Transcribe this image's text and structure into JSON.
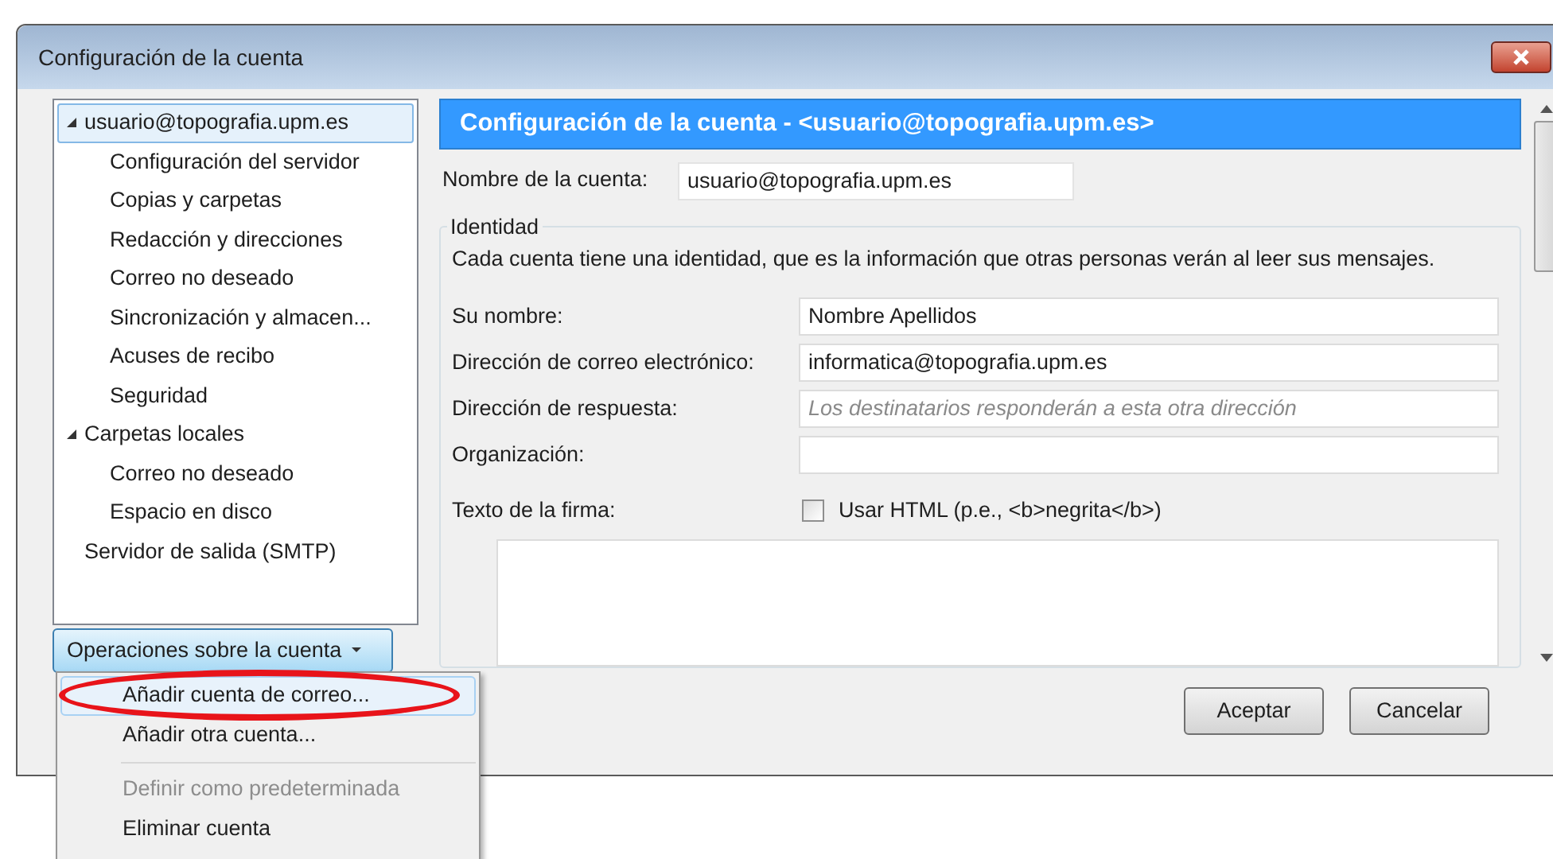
{
  "window": {
    "title": "Configuración de la cuenta"
  },
  "tree": [
    {
      "label": "usuario@topografia.upm.es",
      "selected": true,
      "expanded": true,
      "children": [
        {
          "label": "Configuración del servidor",
          "selected": false
        },
        {
          "label": "Copias y carpetas",
          "selected": false
        },
        {
          "label": "Redacción y direcciones",
          "selected": false
        },
        {
          "label": "Correo no deseado",
          "selected": false
        },
        {
          "label": "Sincronización y almacen...",
          "selected": false
        },
        {
          "label": "Acuses de recibo",
          "selected": false
        },
        {
          "label": "Seguridad",
          "selected": false
        }
      ]
    },
    {
      "label": "Carpetas locales",
      "selected": false,
      "expanded": true,
      "children": [
        {
          "label": "Correo no deseado",
          "selected": false
        },
        {
          "label": "Espacio en disco",
          "selected": false
        }
      ]
    },
    {
      "label": "Servidor de salida (SMTP)",
      "selected": false
    }
  ],
  "account_actions": {
    "label": "Operaciones sobre la cuenta"
  },
  "menu": [
    {
      "kind": "item",
      "label": "Añadir cuenta de correo...",
      "selected": true,
      "disabled": false,
      "circled": true
    },
    {
      "kind": "item",
      "label": "Añadir otra cuenta...",
      "selected": false,
      "disabled": false,
      "circled": false
    },
    {
      "kind": "separator"
    },
    {
      "kind": "item",
      "label": "Definir como predeterminada",
      "selected": false,
      "disabled": true,
      "circled": false
    },
    {
      "kind": "item",
      "label": "Eliminar cuenta",
      "selected": false,
      "disabled": false,
      "circled": false
    }
  ],
  "header": "Configuración de la cuenta - <usuario@topografia.upm.es>",
  "account_name": {
    "label": "Nombre de la cuenta:",
    "value": "usuario@topografia.upm.es"
  },
  "identity": {
    "legend": "Identidad",
    "description": "Cada cuenta tiene una identidad, que es la información que otras personas verán al leer sus mensajes.",
    "fields": [
      {
        "label": "Su nombre:",
        "value": "Nombre Apellidos"
      },
      {
        "label": "Dirección de correo electrónico:",
        "value": "informatica@topografia.upm.es"
      },
      {
        "label": "Dirección de respuesta:",
        "placeholder": "Los destinatarios responderán a esta otra dirección"
      },
      {
        "label": "Organización:"
      }
    ],
    "signature": {
      "label": "Texto de la firma:",
      "html_option": "Usar HTML (p.e., <b>negrita</b>)",
      "checked": false
    }
  },
  "buttons": [
    "Aceptar",
    "Cancelar"
  ]
}
